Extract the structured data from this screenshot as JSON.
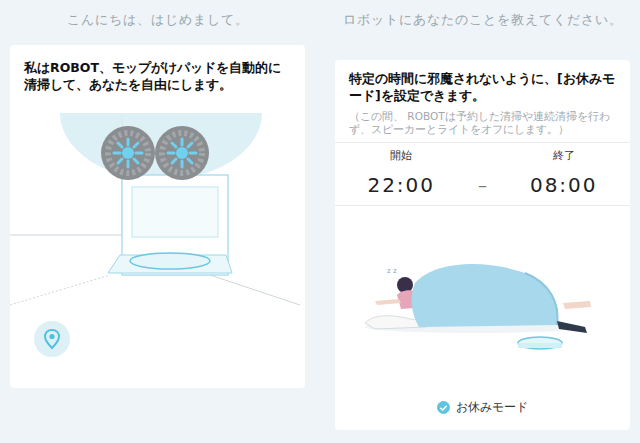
{
  "left": {
    "heading": "こんにちは、はじめまして。",
    "intro": "私はROBOT、モップがけパッドを自動的に清掃して、あなたを自由にします。"
  },
  "right": {
    "heading": "ロボットにあなたのことを教えてください。",
    "description": "特定の時間に邪魔されないように、[お休みモード]を設定できます。",
    "note": "（この間、 ROBOTは予約した清掃や連続清掃を行わず、スピーカーとライトをオフにします。）",
    "schedule": {
      "start_label": "開始",
      "start": "22:00",
      "separator": "–",
      "end_label": "終了",
      "end": "08:00"
    },
    "option": {
      "label": "お休みモード",
      "checked": true
    }
  }
}
